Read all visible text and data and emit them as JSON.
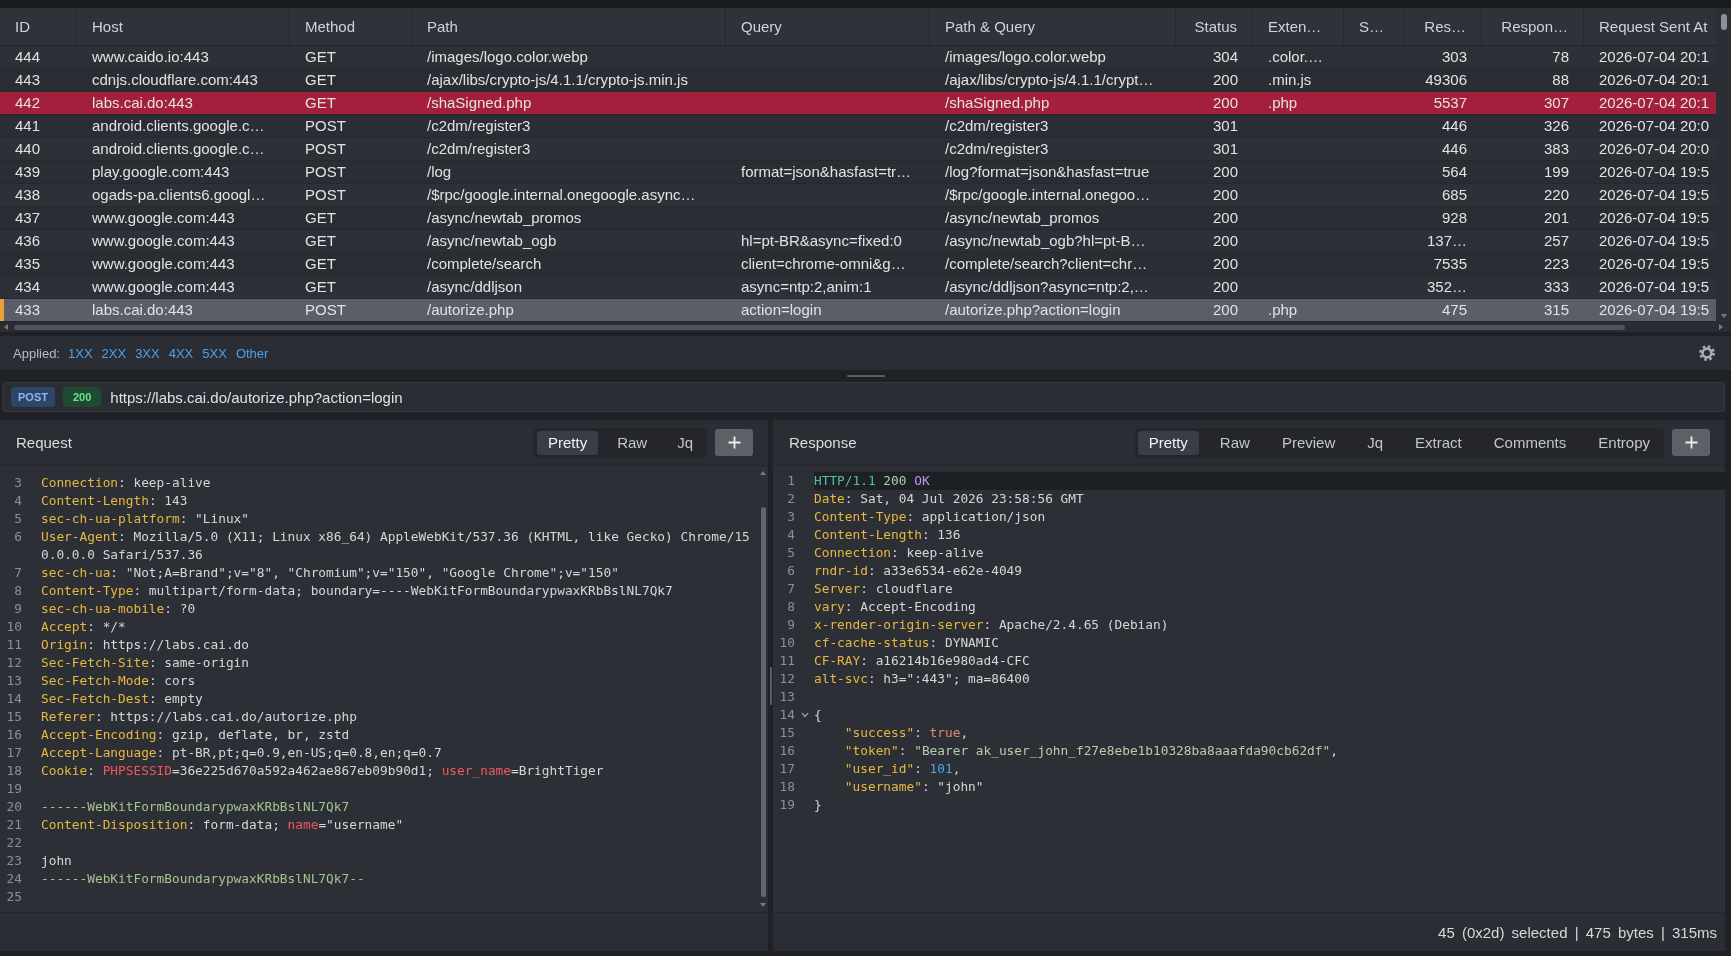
{
  "table": {
    "columns": [
      {
        "label": "ID",
        "kind": "text"
      },
      {
        "label": "Host",
        "kind": "text"
      },
      {
        "label": "Method",
        "kind": "text"
      },
      {
        "label": "Path",
        "kind": "text"
      },
      {
        "label": "Query",
        "kind": "text"
      },
      {
        "label": "Path & Query",
        "kind": "text"
      },
      {
        "label": "Status",
        "kind": "number"
      },
      {
        "label": "Exten…",
        "kind": "text"
      },
      {
        "label": "S…",
        "kind": "text"
      },
      {
        "label": "Res…",
        "kind": "number"
      },
      {
        "label": "Respon…",
        "kind": "number"
      },
      {
        "label": "Request Sent At",
        "kind": "text"
      }
    ],
    "rows": [
      {
        "cells": [
          "444",
          "www.caido.io:443",
          "GET",
          "/images/logo.color.webp",
          null,
          "/images/logo.color.webp",
          "304",
          ".color.…",
          null,
          "303",
          "78",
          "2026-07-04 20:1"
        ],
        "selected": false
      },
      {
        "cells": [
          "443",
          "cdnjs.cloudflare.com:443",
          "GET",
          "/ajax/libs/crypto-js/4.1.1/crypto-js.min.js",
          null,
          "/ajax/libs/crypto-js/4.1.1/crypt…",
          "200",
          ".min.js",
          null,
          "49306",
          "88",
          "2026-07-04 20:1"
        ],
        "selected": false
      },
      {
        "cells": [
          "442",
          "labs.cai.do:443",
          "GET",
          "/shaSigned.php",
          null,
          "/shaSigned.php",
          "200",
          ".php",
          null,
          "5537",
          "307",
          "2026-07-04 20:1"
        ],
        "selected": false,
        "color": "#a31f3b"
      },
      {
        "cells": [
          "441",
          "android.clients.google.c…",
          "POST",
          "/c2dm/register3",
          null,
          "/c2dm/register3",
          "301",
          null,
          null,
          "446",
          "326",
          "2026-07-04 20:0"
        ],
        "selected": false
      },
      {
        "cells": [
          "440",
          "android.clients.google.c…",
          "POST",
          "/c2dm/register3",
          null,
          "/c2dm/register3",
          "301",
          null,
          null,
          "446",
          "383",
          "2026-07-04 20:0"
        ],
        "selected": false
      },
      {
        "cells": [
          "439",
          "play.google.com:443",
          "POST",
          "/log",
          "format=json&hasfast=tr…",
          "/log?format=json&hasfast=true",
          "200",
          null,
          null,
          "564",
          "199",
          "2026-07-04 19:5"
        ],
        "selected": false
      },
      {
        "cells": [
          "438",
          "ogads-pa.clients6.googl…",
          "POST",
          "/$rpc/google.internal.onegoogle.async…",
          null,
          "/$rpc/google.internal.onegoo…",
          "200",
          null,
          null,
          "685",
          "220",
          "2026-07-04 19:5"
        ],
        "selected": false
      },
      {
        "cells": [
          "437",
          "www.google.com:443",
          "GET",
          "/async/newtab_promos",
          null,
          "/async/newtab_promos",
          "200",
          null,
          null,
          "928",
          "201",
          "2026-07-04 19:5"
        ],
        "selected": false
      },
      {
        "cells": [
          "436",
          "www.google.com:443",
          "GET",
          "/async/newtab_ogb",
          "hl=pt-BR&async=fixed:0",
          "/async/newtab_ogb?hl=pt-B…",
          "200",
          null,
          null,
          "137…",
          "257",
          "2026-07-04 19:5"
        ],
        "selected": false
      },
      {
        "cells": [
          "435",
          "www.google.com:443",
          "GET",
          "/complete/search",
          "client=chrome-omni&g…",
          "/complete/search?client=chr…",
          "200",
          null,
          null,
          "7535",
          "223",
          "2026-07-04 19:5"
        ],
        "selected": false
      },
      {
        "cells": [
          "434",
          "www.google.com:443",
          "GET",
          "/async/ddljson",
          "async=ntp:2,anim:1",
          "/async/ddljson?async=ntp:2,…",
          "200",
          null,
          null,
          "352…",
          "333",
          "2026-07-04 19:5"
        ],
        "selected": false
      },
      {
        "cells": [
          "433",
          "labs.cai.do:443",
          "POST",
          "/autorize.php",
          "action=login",
          "/autorize.php?action=login",
          "200",
          ".php",
          null,
          "475",
          "315",
          "2026-07-04 19:5"
        ],
        "selected": true
      }
    ]
  },
  "filter_bar": {
    "label": "Applied:",
    "filters": [
      "1XX",
      "2XX",
      "3XX",
      "4XX",
      "5XX",
      "Other"
    ]
  },
  "request_bar": {
    "method": "POST",
    "status": "200",
    "url": "https://labs.cai.do/autorize.php?action=login"
  },
  "request_pane": {
    "title": "Request",
    "tabs": [
      {
        "label": "Pretty",
        "selected": true
      },
      {
        "label": "Raw",
        "selected": false
      },
      {
        "label": "Jq",
        "selected": false
      }
    ],
    "lines": [
      {
        "number": "3",
        "parts": [
          {
            "kind": "key",
            "text": "Connection"
          },
          {
            "kind": "text",
            "text": ": keep-alive"
          }
        ]
      },
      {
        "number": "4",
        "parts": [
          {
            "kind": "key",
            "text": "Content-Length"
          },
          {
            "kind": "text",
            "text": ": 143"
          }
        ]
      },
      {
        "number": "5",
        "parts": [
          {
            "kind": "key",
            "text": "sec-ch-ua-platform"
          },
          {
            "kind": "text",
            "text": ": \"Linux\""
          }
        ]
      },
      {
        "number": "6",
        "parts": [
          {
            "kind": "key",
            "text": "User-Agent"
          },
          {
            "kind": "text",
            "text": ": Mozilla/5.0 (X11; Linux x86_64) AppleWebKit/537.36 (KHTML, like Gecko) Chrome/150.0.0.0 Safari/537.36"
          }
        ]
      },
      {
        "number": "7",
        "parts": [
          {
            "kind": "key",
            "text": "sec-ch-ua"
          },
          {
            "kind": "text",
            "text": ": \"Not;A=Brand\";v=\"8\", \"Chromium\";v=\"150\", \"Google Chrome\";v=\"150\""
          }
        ]
      },
      {
        "number": "8",
        "parts": [
          {
            "kind": "key",
            "text": "Content-Type"
          },
          {
            "kind": "text",
            "text": ": multipart/form-data; boundary=----WebKitFormBoundarypwaxKRbBslNL7Qk7"
          }
        ]
      },
      {
        "number": "9",
        "parts": [
          {
            "kind": "key",
            "text": "sec-ch-ua-mobile"
          },
          {
            "kind": "text",
            "text": ": ?0"
          }
        ]
      },
      {
        "number": "10",
        "parts": [
          {
            "kind": "key",
            "text": "Accept"
          },
          {
            "kind": "text",
            "text": ": */*"
          }
        ]
      },
      {
        "number": "11",
        "parts": [
          {
            "kind": "key",
            "text": "Origin"
          },
          {
            "kind": "text",
            "text": ": https://labs.cai.do"
          }
        ]
      },
      {
        "number": "12",
        "parts": [
          {
            "kind": "key",
            "text": "Sec-Fetch-Site"
          },
          {
            "kind": "text",
            "text": ": same-origin"
          }
        ]
      },
      {
        "number": "13",
        "parts": [
          {
            "kind": "key",
            "text": "Sec-Fetch-Mode"
          },
          {
            "kind": "text",
            "text": ": cors"
          }
        ]
      },
      {
        "number": "14",
        "parts": [
          {
            "kind": "key",
            "text": "Sec-Fetch-Dest"
          },
          {
            "kind": "text",
            "text": ": empty"
          }
        ]
      },
      {
        "number": "15",
        "parts": [
          {
            "kind": "key",
            "text": "Referer"
          },
          {
            "kind": "text",
            "text": ": https://labs.cai.do/autorize.php"
          }
        ]
      },
      {
        "number": "16",
        "parts": [
          {
            "kind": "key",
            "text": "Accept-Encoding"
          },
          {
            "kind": "text",
            "text": ": gzip, deflate, br, zstd"
          }
        ]
      },
      {
        "number": "17",
        "parts": [
          {
            "kind": "key",
            "text": "Accept-Language"
          },
          {
            "kind": "text",
            "text": ": pt-BR,pt;q=0.9,en-US;q=0.8,en;q=0.7"
          }
        ]
      },
      {
        "number": "18",
        "parts": [
          {
            "kind": "key",
            "text": "Cookie"
          },
          {
            "kind": "text",
            "text": ": "
          },
          {
            "kind": "name",
            "text": "PHPSESSID"
          },
          {
            "kind": "text",
            "text": "=36e225d670a592a462ae867eb09b90d1; "
          },
          {
            "kind": "name",
            "text": "user_name"
          },
          {
            "kind": "text",
            "text": "=BrightTiger"
          }
        ]
      },
      {
        "number": "19"
      },
      {
        "number": "20",
        "parts": [
          {
            "kind": "boundary",
            "text": "------WebKitFormBoundarypwaxKRbBslNL7Qk7"
          }
        ]
      },
      {
        "number": "21",
        "parts": [
          {
            "kind": "key",
            "text": "Content-Disposition"
          },
          {
            "kind": "text",
            "text": ": form-data; "
          },
          {
            "kind": "name",
            "text": "name"
          },
          {
            "kind": "text",
            "text": "=\"username\""
          }
        ]
      },
      {
        "number": "22"
      },
      {
        "number": "23",
        "parts": [
          {
            "kind": "text",
            "text": "john"
          }
        ]
      },
      {
        "number": "24",
        "parts": [
          {
            "kind": "boundary",
            "text": "------WebKitFormBoundarypwaxKRbBslNL7Qk7--"
          }
        ]
      },
      {
        "number": "25"
      }
    ]
  },
  "response_pane": {
    "title": "Response",
    "tabs": [
      {
        "label": "Pretty",
        "selected": true
      },
      {
        "label": "Raw",
        "selected": false
      },
      {
        "label": "Preview",
        "selected": false
      },
      {
        "label": "Jq",
        "selected": false
      },
      {
        "label": "Extract",
        "selected": false
      },
      {
        "label": "Comments",
        "selected": false
      },
      {
        "label": "Entropy",
        "selected": false
      }
    ],
    "lines": [
      {
        "number": "1",
        "current": true,
        "parts": [
          {
            "kind": "protocol",
            "text": "HTTP/1.1"
          },
          {
            "kind": "status",
            "text": " 200"
          },
          {
            "kind": "reason",
            "text": " OK"
          }
        ]
      },
      {
        "number": "2",
        "current": false,
        "parts": [
          {
            "kind": "key",
            "text": "Date"
          },
          {
            "kind": "text",
            "text": ": Sat, 04 Jul 2026 23:58:56 GMT"
          }
        ]
      },
      {
        "number": "3",
        "current": false,
        "parts": [
          {
            "kind": "key",
            "text": "Content-Type"
          },
          {
            "kind": "text",
            "text": ": application/json"
          }
        ]
      },
      {
        "number": "4",
        "current": false,
        "parts": [
          {
            "kind": "key",
            "text": "Content-Length"
          },
          {
            "kind": "text",
            "text": ": 136"
          }
        ]
      },
      {
        "number": "5",
        "current": false,
        "parts": [
          {
            "kind": "key",
            "text": "Connection"
          },
          {
            "kind": "text",
            "text": ": keep-alive"
          }
        ]
      },
      {
        "number": "6",
        "current": false,
        "parts": [
          {
            "kind": "key",
            "text": "rndr-id"
          },
          {
            "kind": "text",
            "text": ": a33e6534-e62e-4049"
          }
        ]
      },
      {
        "number": "7",
        "current": false,
        "parts": [
          {
            "kind": "key",
            "text": "Server"
          },
          {
            "kind": "text",
            "text": ": cloudflare"
          }
        ]
      },
      {
        "number": "8",
        "current": false,
        "parts": [
          {
            "kind": "key",
            "text": "vary"
          },
          {
            "kind": "text",
            "text": ": Accept-Encoding"
          }
        ]
      },
      {
        "number": "9",
        "current": false,
        "parts": [
          {
            "kind": "key",
            "text": "x-render-origin-server"
          },
          {
            "kind": "text",
            "text": ": Apache/2.4.65 (Debian)"
          }
        ]
      },
      {
        "number": "10",
        "current": false,
        "parts": [
          {
            "kind": "key",
            "text": "cf-cache-status"
          },
          {
            "kind": "text",
            "text": ": DYNAMIC"
          }
        ]
      },
      {
        "number": "11",
        "current": false,
        "parts": [
          {
            "kind": "key",
            "text": "CF-RAY"
          },
          {
            "kind": "text",
            "text": ": a16214b16e980ad4-CFC"
          }
        ]
      },
      {
        "number": "12",
        "current": false,
        "parts": [
          {
            "kind": "key",
            "text": "alt-svc"
          },
          {
            "kind": "text",
            "text": ": h3=\":443\"; ma=86400"
          }
        ]
      },
      {
        "number": "13",
        "current": false
      },
      {
        "number": "14",
        "current": false,
        "fold": true,
        "parts": [
          {
            "kind": "text",
            "text": "{"
          }
        ]
      },
      {
        "number": "15",
        "current": false,
        "parts": [
          {
            "kind": "json_key",
            "text": "    \"success\""
          },
          {
            "kind": "text",
            "text": ": "
          },
          {
            "kind": "bool",
            "text": "true"
          },
          {
            "kind": "text",
            "text": ","
          }
        ]
      },
      {
        "number": "16",
        "current": false,
        "parts": [
          {
            "kind": "json_key",
            "text": "    \"token\""
          },
          {
            "kind": "text",
            "text": ": "
          },
          {
            "kind": "string",
            "text": "\"Bearer ak_user_john_f27e8ebe1b10328ba8aaafda90cb62df\""
          },
          {
            "kind": "text",
            "text": ","
          }
        ]
      },
      {
        "number": "17",
        "current": false,
        "parts": [
          {
            "kind": "json_key",
            "text": "    \"user_id\""
          },
          {
            "kind": "text",
            "text": ": "
          },
          {
            "kind": "number",
            "text": "101"
          },
          {
            "kind": "text",
            "text": ","
          }
        ]
      },
      {
        "number": "18",
        "current": false,
        "parts": [
          {
            "kind": "json_key",
            "text": "    \"username\""
          },
          {
            "kind": "text",
            "text": ": \"john\""
          }
        ]
      },
      {
        "number": "19",
        "current": false,
        "parts": [
          {
            "kind": "text",
            "text": "}"
          }
        ]
      }
    ],
    "status_bar": "45 (0x2d) selected | 475 bytes | 315ms"
  }
}
